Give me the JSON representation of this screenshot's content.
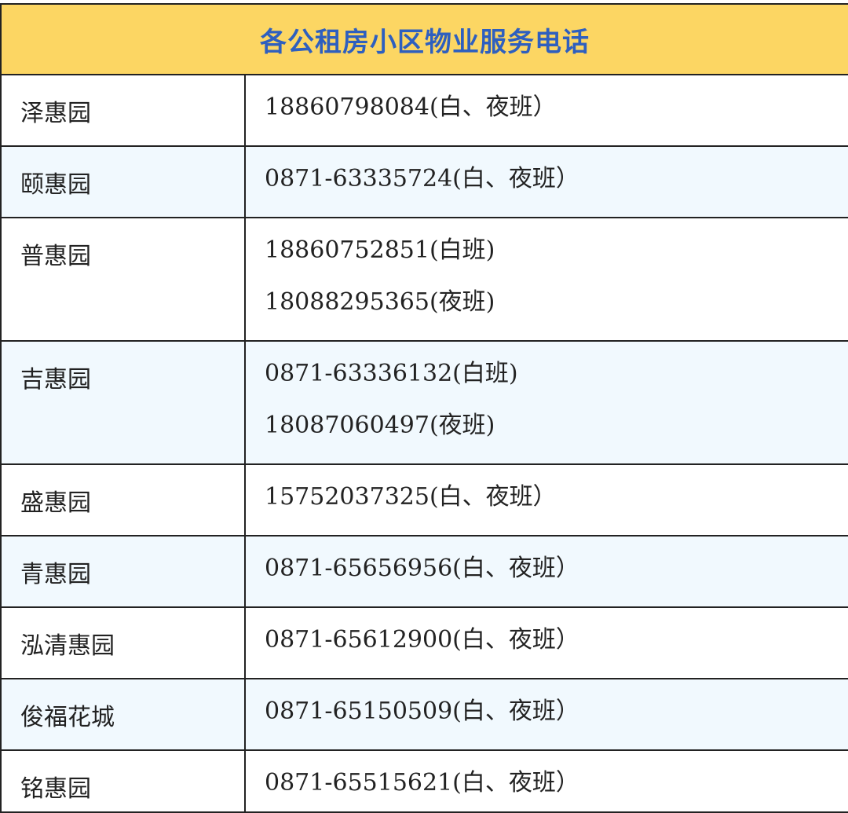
{
  "title": "各公租房小区物业服务电话",
  "rows": [
    {
      "name": "泽惠园",
      "phones": [
        "18860798084(白、夜班）"
      ]
    },
    {
      "name": "颐惠园",
      "phones": [
        "0871-63335724(白、夜班）"
      ]
    },
    {
      "name": "普惠园",
      "phones": [
        "18860752851(白班)",
        "18088295365(夜班)"
      ]
    },
    {
      "name": "吉惠园",
      "phones": [
        "0871-63336132(白班)",
        "18087060497(夜班)"
      ]
    },
    {
      "name": "盛惠园",
      "phones": [
        "15752037325(白、夜班）"
      ]
    },
    {
      "name": "青惠园",
      "phones": [
        "0871-65656956(白、夜班）"
      ]
    },
    {
      "name": "泓清惠园",
      "phones": [
        "0871-65612900(白、夜班）"
      ]
    },
    {
      "name": "俊福花城",
      "phones": [
        "0871-65150509(白、夜班）"
      ]
    },
    {
      "name": "铭惠园",
      "phones": [
        "0871-65515621(白、夜班）"
      ]
    }
  ],
  "colors": {
    "header_bg": "#fcd663",
    "header_text": "#2e5fbf",
    "alt_row_bg": "#f1f9fe",
    "border": "#222222"
  }
}
